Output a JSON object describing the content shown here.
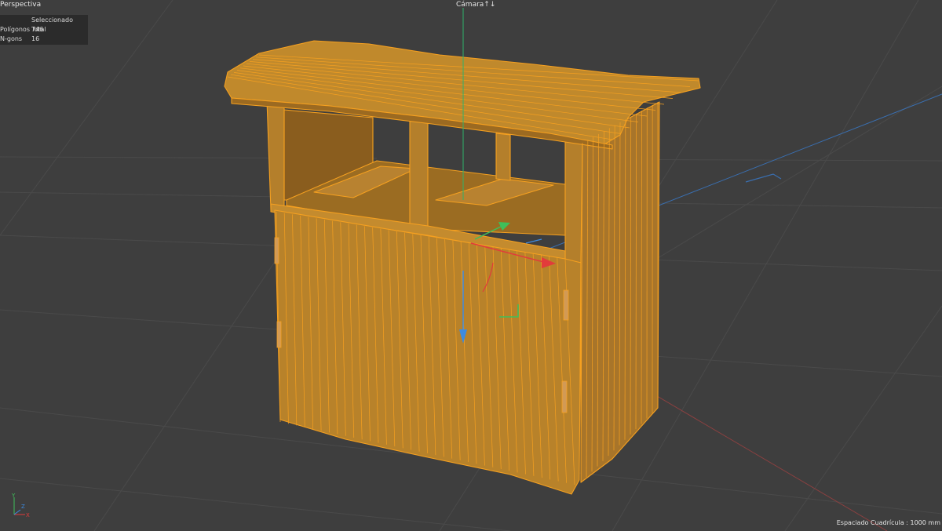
{
  "viewport": {
    "view_name": "Perspectiva",
    "camera_label": "Cámara",
    "camera_icon": "camera-toggle-icon",
    "grid_spacing": "Espaciado Cuadrícula : 1000 mm"
  },
  "stats": {
    "header": "Seleccionado Total",
    "rows": [
      {
        "label": "Polígonos",
        "value": "746"
      },
      {
        "label": "N-gons",
        "value": "16"
      }
    ]
  },
  "axis_indicator": {
    "y": "Y",
    "z": "Z",
    "x": "X"
  },
  "colors": {
    "background": "#3e3e3e",
    "grid": "#4b4b4b",
    "model_fill": "#b8822a",
    "model_wire": "#f5a020",
    "axis_x": "#e23b3b",
    "axis_y": "#3fbf5a",
    "axis_z": "#3d8be0"
  }
}
